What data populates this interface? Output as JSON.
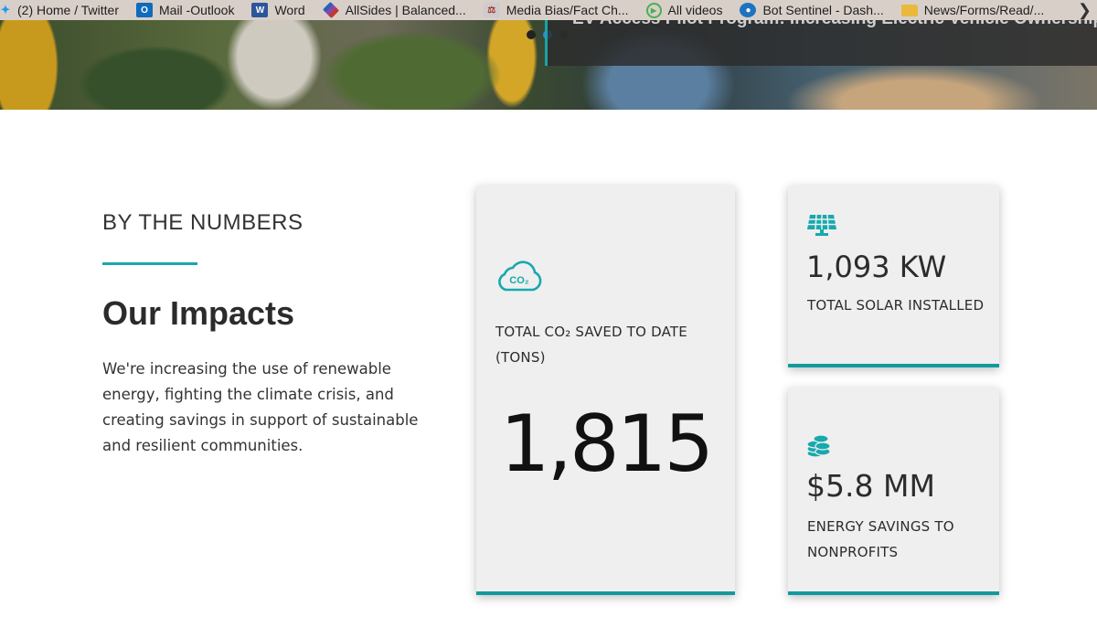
{
  "bookmarks": [
    {
      "label": "(2) Home / Twitter",
      "icon": "twitter-icon",
      "color": "#1d9bf0"
    },
    {
      "label": "Mail -Outlook",
      "icon": "outlook-icon",
      "color": "#0f6cbd"
    },
    {
      "label": "Word",
      "icon": "word-icon",
      "color": "#2b579a"
    },
    {
      "label": "AllSides | Balanced...",
      "icon": "allsides-icon",
      "color": "#c0392b"
    },
    {
      "label": "Media Bias/Fact Ch...",
      "icon": "mbfc-icon",
      "color": "#b03030"
    },
    {
      "label": "All videos",
      "icon": "play-icon",
      "color": "#4caf50"
    },
    {
      "label": "Bot Sentinel - Dash...",
      "icon": "botsentinel-icon",
      "color": "#1e73be"
    },
    {
      "label": "News/Forms/Read/...",
      "icon": "folder-icon",
      "color": "#e8b93c"
    }
  ],
  "hero": {
    "caption": "EV Access Pilot Program: Increasing Electric Vehicle Ownership in Environmental"
  },
  "section": {
    "eyebrow": "BY THE NUMBERS",
    "heading": "Our Impacts",
    "description": "We're increasing the use of renewable energy, fighting the climate crisis, and creating savings in support of sustainable and resilient communities."
  },
  "stats": {
    "co2": {
      "icon": "co2-cloud-icon",
      "icon_text": "CO₂",
      "label": "TOTAL CO₂ SAVED TO DATE (TONS)",
      "value": "1,815"
    },
    "solar": {
      "icon": "solar-panel-icon",
      "value": "1,093 KW",
      "label": "TOTAL SOLAR INSTALLED"
    },
    "savings": {
      "icon": "coins-icon",
      "value": "$5.8 MM",
      "label": "ENERGY SAVINGS TO NONPROFITS"
    }
  },
  "colors": {
    "accent": "#17a9ad",
    "card_bg": "#efefef",
    "bookmark_bar": "#d9cfc9"
  }
}
